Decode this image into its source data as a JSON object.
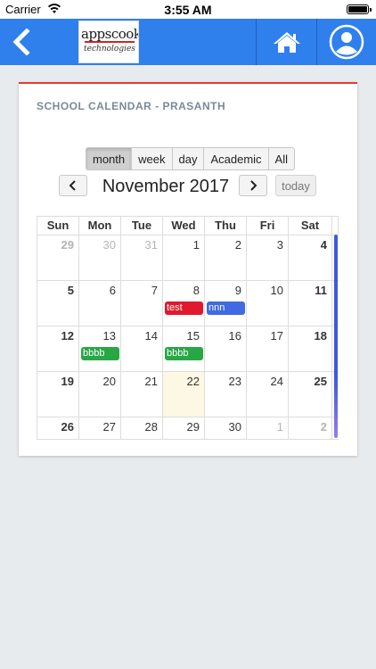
{
  "status_bar": {
    "carrier": "Carrier",
    "time": "3:55 AM"
  },
  "header": {
    "logo_main": "appscook",
    "logo_sub": "technologies",
    "back_icon": "chevron-left-icon",
    "home_icon": "home-icon",
    "user_icon": "user-circle-icon"
  },
  "card": {
    "title": "SCHOOL CALENDAR - PRASANTH",
    "views": [
      {
        "label": "month",
        "active": true
      },
      {
        "label": "week",
        "active": false
      },
      {
        "label": "day",
        "active": false
      },
      {
        "label": "Academic",
        "active": false
      },
      {
        "label": "All",
        "active": false
      }
    ],
    "month_title": "November 2017",
    "today_label": "today",
    "prev_icon": "chevron-left-icon",
    "next_icon": "chevron-right-icon"
  },
  "calendar": {
    "days_of_week": [
      "Sun",
      "Mon",
      "Tue",
      "Wed",
      "Thu",
      "Fri",
      "Sat"
    ],
    "weeks": [
      [
        {
          "d": "29",
          "other": true
        },
        {
          "d": "30",
          "other": true
        },
        {
          "d": "31",
          "other": true
        },
        {
          "d": "1"
        },
        {
          "d": "2"
        },
        {
          "d": "3"
        },
        {
          "d": "4"
        }
      ],
      [
        {
          "d": "5"
        },
        {
          "d": "6"
        },
        {
          "d": "7"
        },
        {
          "d": "8",
          "event": "test",
          "color": "#e0192e"
        },
        {
          "d": "9",
          "event": "nnn",
          "color": "#4169e1"
        },
        {
          "d": "10"
        },
        {
          "d": "11"
        }
      ],
      [
        {
          "d": "12"
        },
        {
          "d": "13",
          "event": "bbbb",
          "color": "#28a745"
        },
        {
          "d": "14"
        },
        {
          "d": "15",
          "event": "bbbb",
          "color": "#28a745"
        },
        {
          "d": "16"
        },
        {
          "d": "17"
        },
        {
          "d": "18"
        }
      ],
      [
        {
          "d": "19"
        },
        {
          "d": "20"
        },
        {
          "d": "21"
        },
        {
          "d": "22",
          "today": true
        },
        {
          "d": "23"
        },
        {
          "d": "24"
        },
        {
          "d": "25"
        }
      ],
      [
        {
          "d": "26"
        },
        {
          "d": "27"
        },
        {
          "d": "28"
        },
        {
          "d": "29"
        },
        {
          "d": "30"
        },
        {
          "d": "1",
          "other": true
        },
        {
          "d": "2",
          "other": true
        }
      ]
    ]
  },
  "colors": {
    "header_blue": "#2f80ed",
    "card_accent": "#e53935",
    "today_bg": "#fcf8e3",
    "scrollbar_top": "#3b5bdb",
    "scrollbar_bottom": "#9b7be8"
  }
}
